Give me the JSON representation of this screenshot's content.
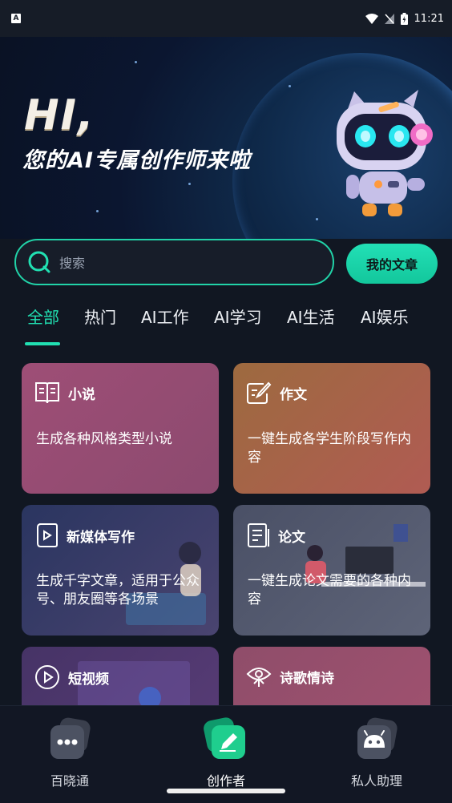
{
  "status_bar": {
    "time": "11:21"
  },
  "hero": {
    "greeting": "HI,",
    "tagline": "您的AI专属创作师来啦"
  },
  "search": {
    "placeholder": "搜索"
  },
  "my_articles_button": "我的文章",
  "tabs": [
    {
      "label": "全部",
      "active": true
    },
    {
      "label": "热门",
      "active": false
    },
    {
      "label": "AI工作",
      "active": false
    },
    {
      "label": "AI学习",
      "active": false
    },
    {
      "label": "AI生活",
      "active": false
    },
    {
      "label": "AI娱乐",
      "active": false
    }
  ],
  "cards": [
    {
      "title": "小说",
      "desc": "生成各种风格类型小说",
      "icon": "book-icon"
    },
    {
      "title": "作文",
      "desc": "一键生成各学生阶段写作内容",
      "icon": "edit-icon"
    },
    {
      "title": "新媒体写作",
      "desc": "生成千字文章，适用于公众号、朋友圈等各场景",
      "icon": "scroll-play-icon"
    },
    {
      "title": "论文",
      "desc": "一键生成论文需要的各种内容",
      "icon": "document-icon"
    },
    {
      "title": "短视频",
      "desc": "",
      "icon": "play-circle-icon"
    },
    {
      "title": "诗歌情诗",
      "desc": "",
      "icon": "lotus-icon"
    }
  ],
  "bottom_nav": [
    {
      "label": "百晓通",
      "icon": "more-dots-icon",
      "active": false
    },
    {
      "label": "创作者",
      "icon": "pen-icon",
      "active": true
    },
    {
      "label": "私人助理",
      "icon": "robot-icon",
      "active": false
    }
  ],
  "colors": {
    "accent": "#21e0b2",
    "background": "#111722"
  }
}
